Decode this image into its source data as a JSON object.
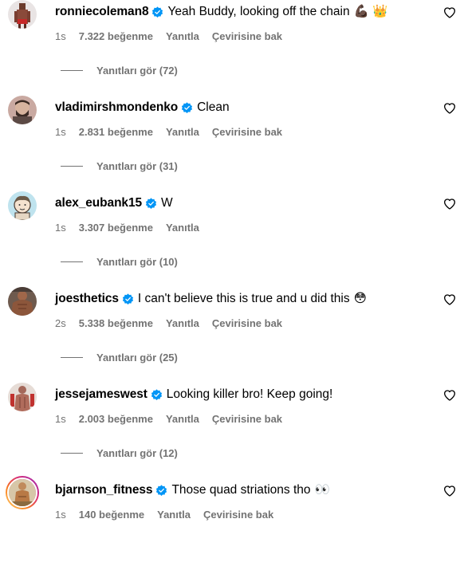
{
  "comments": [
    {
      "username": "ronniecoleman8",
      "text": "Yeah Buddy, looking off the chain",
      "emoji": "💪🏿 👑",
      "time": "1s",
      "likes": "7.322 beğenme",
      "reply": "Yanıtla",
      "translate": "Çevirisine bak",
      "view_replies": "Yanıtları gör (72)"
    },
    {
      "username": "vladimirshmondenko",
      "text": "Clean",
      "emoji": "",
      "time": "1s",
      "likes": "2.831 beğenme",
      "reply": "Yanıtla",
      "translate": "Çevirisine bak",
      "view_replies": "Yanıtları gör (31)"
    },
    {
      "username": "alex_eubank15",
      "text": "W",
      "emoji": "",
      "time": "1s",
      "likes": "3.307 beğenme",
      "reply": "Yanıtla",
      "translate": "",
      "view_replies": "Yanıtları gör (10)"
    },
    {
      "username": "joesthetics",
      "text": "I can't believe this is true and u did this",
      "emoji": "😳",
      "time": "2s",
      "likes": "5.338 beğenme",
      "reply": "Yanıtla",
      "translate": "Çevirisine bak",
      "view_replies": "Yanıtları gör (25)"
    },
    {
      "username": "jessejameswest",
      "text": "Looking killer bro! Keep going!",
      "emoji": "",
      "time": "1s",
      "likes": "2.003 beğenme",
      "reply": "Yanıtla",
      "translate": "Çevirisine bak",
      "view_replies": "Yanıtları gör (12)"
    },
    {
      "username": "bjarnson_fitness",
      "text": "Those quad striations tho",
      "emoji": "👀",
      "time": "1s",
      "likes": "140 beğenme",
      "reply": "Yanıtla",
      "translate": "Çevirisine bak",
      "view_replies": ""
    }
  ],
  "icons": {
    "verified": "verified-badge-icon",
    "like": "heart-outline-icon"
  },
  "colors": {
    "verified_blue": "#0095f6",
    "secondary_text": "#737373"
  }
}
